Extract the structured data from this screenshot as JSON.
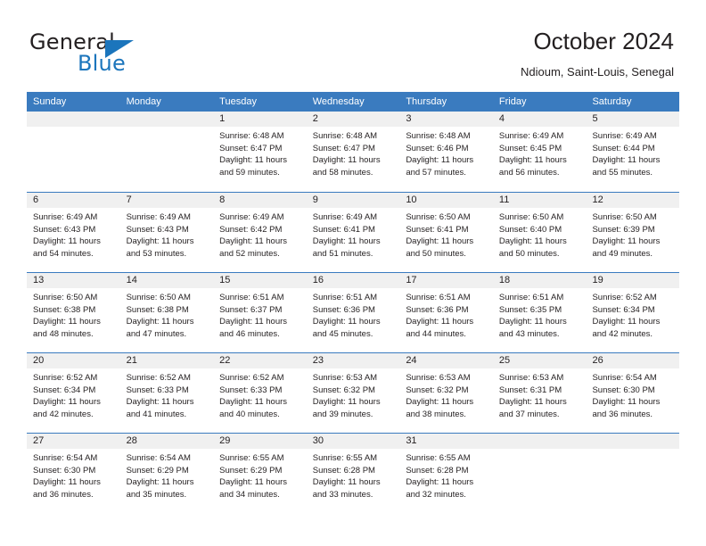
{
  "brand": {
    "name_top": "General",
    "name_bottom": "Blue",
    "triangle_color": "#1b75bc",
    "text_color": "#231f20"
  },
  "header": {
    "title": "October 2024",
    "subtitle": "Ndioum, Saint-Louis, Senegal"
  },
  "theme": {
    "header_bar": "#3a7bbf",
    "daynum_band": "#f0f0f0",
    "text": "#231f20",
    "accent": "#1b75bc"
  },
  "weekdays": [
    "Sunday",
    "Monday",
    "Tuesday",
    "Wednesday",
    "Thursday",
    "Friday",
    "Saturday"
  ],
  "labels": {
    "sunrise_prefix": "Sunrise:",
    "sunset_prefix": "Sunset:",
    "daylight_prefix": "Daylight:"
  },
  "weeks": [
    [
      {
        "day": "",
        "sunrise": "",
        "sunset": "",
        "daylight": ""
      },
      {
        "day": "",
        "sunrise": "",
        "sunset": "",
        "daylight": ""
      },
      {
        "day": "1",
        "sunrise": "Sunrise: 6:48 AM",
        "sunset": "Sunset: 6:47 PM",
        "daylight": "Daylight: 11 hours and 59 minutes."
      },
      {
        "day": "2",
        "sunrise": "Sunrise: 6:48 AM",
        "sunset": "Sunset: 6:47 PM",
        "daylight": "Daylight: 11 hours and 58 minutes."
      },
      {
        "day": "3",
        "sunrise": "Sunrise: 6:48 AM",
        "sunset": "Sunset: 6:46 PM",
        "daylight": "Daylight: 11 hours and 57 minutes."
      },
      {
        "day": "4",
        "sunrise": "Sunrise: 6:49 AM",
        "sunset": "Sunset: 6:45 PM",
        "daylight": "Daylight: 11 hours and 56 minutes."
      },
      {
        "day": "5",
        "sunrise": "Sunrise: 6:49 AM",
        "sunset": "Sunset: 6:44 PM",
        "daylight": "Daylight: 11 hours and 55 minutes."
      }
    ],
    [
      {
        "day": "6",
        "sunrise": "Sunrise: 6:49 AM",
        "sunset": "Sunset: 6:43 PM",
        "daylight": "Daylight: 11 hours and 54 minutes."
      },
      {
        "day": "7",
        "sunrise": "Sunrise: 6:49 AM",
        "sunset": "Sunset: 6:43 PM",
        "daylight": "Daylight: 11 hours and 53 minutes."
      },
      {
        "day": "8",
        "sunrise": "Sunrise: 6:49 AM",
        "sunset": "Sunset: 6:42 PM",
        "daylight": "Daylight: 11 hours and 52 minutes."
      },
      {
        "day": "9",
        "sunrise": "Sunrise: 6:49 AM",
        "sunset": "Sunset: 6:41 PM",
        "daylight": "Daylight: 11 hours and 51 minutes."
      },
      {
        "day": "10",
        "sunrise": "Sunrise: 6:50 AM",
        "sunset": "Sunset: 6:41 PM",
        "daylight": "Daylight: 11 hours and 50 minutes."
      },
      {
        "day": "11",
        "sunrise": "Sunrise: 6:50 AM",
        "sunset": "Sunset: 6:40 PM",
        "daylight": "Daylight: 11 hours and 50 minutes."
      },
      {
        "day": "12",
        "sunrise": "Sunrise: 6:50 AM",
        "sunset": "Sunset: 6:39 PM",
        "daylight": "Daylight: 11 hours and 49 minutes."
      }
    ],
    [
      {
        "day": "13",
        "sunrise": "Sunrise: 6:50 AM",
        "sunset": "Sunset: 6:38 PM",
        "daylight": "Daylight: 11 hours and 48 minutes."
      },
      {
        "day": "14",
        "sunrise": "Sunrise: 6:50 AM",
        "sunset": "Sunset: 6:38 PM",
        "daylight": "Daylight: 11 hours and 47 minutes."
      },
      {
        "day": "15",
        "sunrise": "Sunrise: 6:51 AM",
        "sunset": "Sunset: 6:37 PM",
        "daylight": "Daylight: 11 hours and 46 minutes."
      },
      {
        "day": "16",
        "sunrise": "Sunrise: 6:51 AM",
        "sunset": "Sunset: 6:36 PM",
        "daylight": "Daylight: 11 hours and 45 minutes."
      },
      {
        "day": "17",
        "sunrise": "Sunrise: 6:51 AM",
        "sunset": "Sunset: 6:36 PM",
        "daylight": "Daylight: 11 hours and 44 minutes."
      },
      {
        "day": "18",
        "sunrise": "Sunrise: 6:51 AM",
        "sunset": "Sunset: 6:35 PM",
        "daylight": "Daylight: 11 hours and 43 minutes."
      },
      {
        "day": "19",
        "sunrise": "Sunrise: 6:52 AM",
        "sunset": "Sunset: 6:34 PM",
        "daylight": "Daylight: 11 hours and 42 minutes."
      }
    ],
    [
      {
        "day": "20",
        "sunrise": "Sunrise: 6:52 AM",
        "sunset": "Sunset: 6:34 PM",
        "daylight": "Daylight: 11 hours and 42 minutes."
      },
      {
        "day": "21",
        "sunrise": "Sunrise: 6:52 AM",
        "sunset": "Sunset: 6:33 PM",
        "daylight": "Daylight: 11 hours and 41 minutes."
      },
      {
        "day": "22",
        "sunrise": "Sunrise: 6:52 AM",
        "sunset": "Sunset: 6:33 PM",
        "daylight": "Daylight: 11 hours and 40 minutes."
      },
      {
        "day": "23",
        "sunrise": "Sunrise: 6:53 AM",
        "sunset": "Sunset: 6:32 PM",
        "daylight": "Daylight: 11 hours and 39 minutes."
      },
      {
        "day": "24",
        "sunrise": "Sunrise: 6:53 AM",
        "sunset": "Sunset: 6:32 PM",
        "daylight": "Daylight: 11 hours and 38 minutes."
      },
      {
        "day": "25",
        "sunrise": "Sunrise: 6:53 AM",
        "sunset": "Sunset: 6:31 PM",
        "daylight": "Daylight: 11 hours and 37 minutes."
      },
      {
        "day": "26",
        "sunrise": "Sunrise: 6:54 AM",
        "sunset": "Sunset: 6:30 PM",
        "daylight": "Daylight: 11 hours and 36 minutes."
      }
    ],
    [
      {
        "day": "27",
        "sunrise": "Sunrise: 6:54 AM",
        "sunset": "Sunset: 6:30 PM",
        "daylight": "Daylight: 11 hours and 36 minutes."
      },
      {
        "day": "28",
        "sunrise": "Sunrise: 6:54 AM",
        "sunset": "Sunset: 6:29 PM",
        "daylight": "Daylight: 11 hours and 35 minutes."
      },
      {
        "day": "29",
        "sunrise": "Sunrise: 6:55 AM",
        "sunset": "Sunset: 6:29 PM",
        "daylight": "Daylight: 11 hours and 34 minutes."
      },
      {
        "day": "30",
        "sunrise": "Sunrise: 6:55 AM",
        "sunset": "Sunset: 6:28 PM",
        "daylight": "Daylight: 11 hours and 33 minutes."
      },
      {
        "day": "31",
        "sunrise": "Sunrise: 6:55 AM",
        "sunset": "Sunset: 6:28 PM",
        "daylight": "Daylight: 11 hours and 32 minutes."
      },
      {
        "day": "",
        "sunrise": "",
        "sunset": "",
        "daylight": ""
      },
      {
        "day": "",
        "sunrise": "",
        "sunset": "",
        "daylight": ""
      }
    ]
  ]
}
